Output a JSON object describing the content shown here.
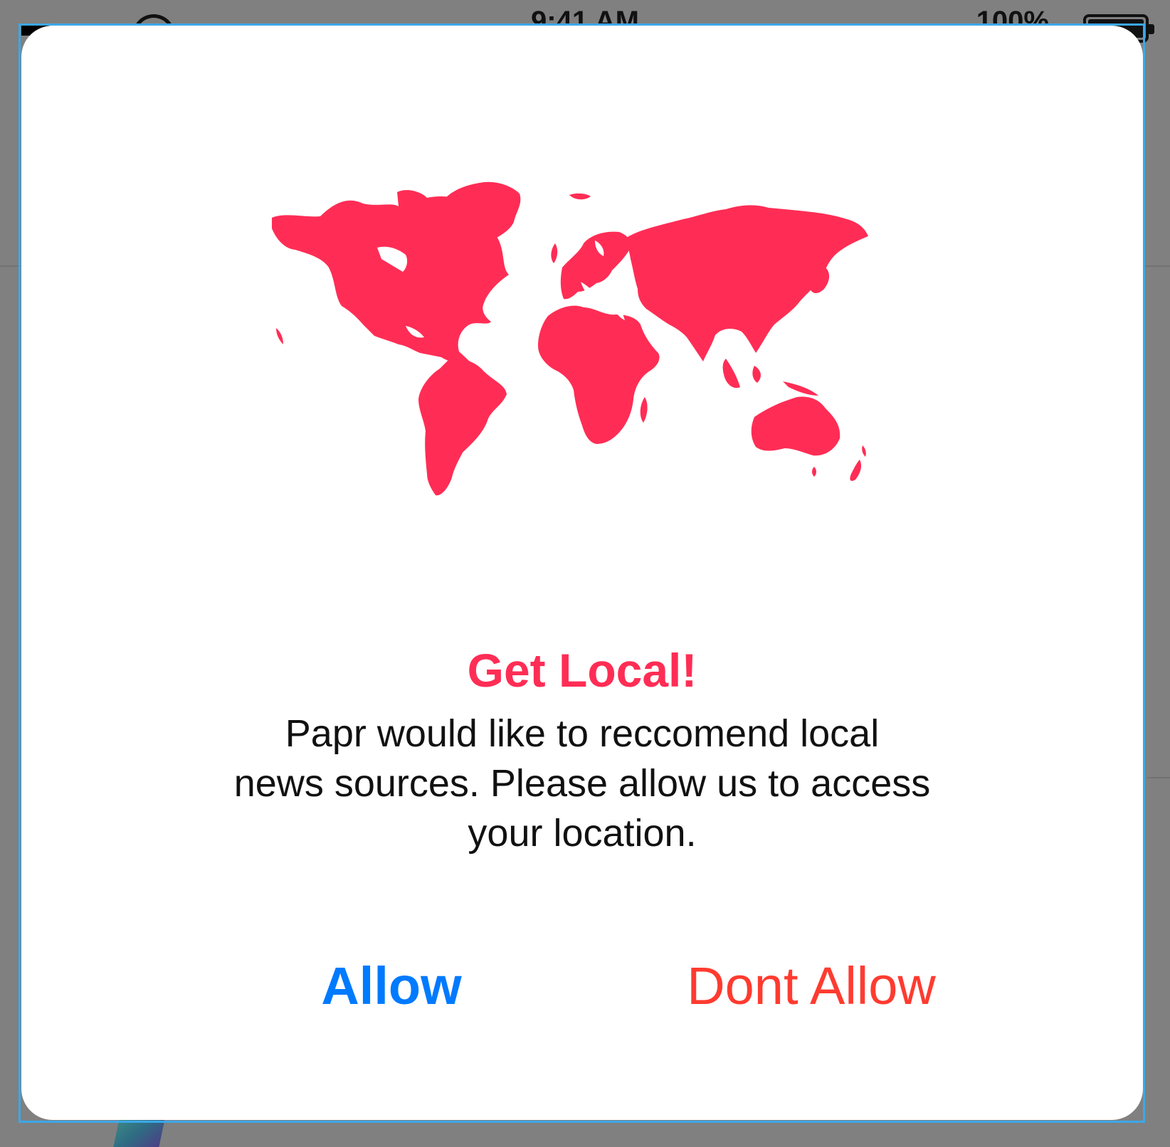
{
  "status_bar": {
    "time": "9:41 AM",
    "battery": "100%"
  },
  "dialog": {
    "title": "Get Local!",
    "message_lines": [
      "Papr would like to reccomend local",
      "news sources. Please allow us to access",
      "your location."
    ],
    "allow_label": "Allow",
    "dont_allow_label": "Dont Allow",
    "illustration": "world-map-icon"
  },
  "colors": {
    "accent_red": "#ff2d55",
    "allow_blue": "#007aff",
    "dont_allow_red": "#ff3b30",
    "backdrop": "#808080",
    "selection_outline": "#3ba8e8"
  }
}
